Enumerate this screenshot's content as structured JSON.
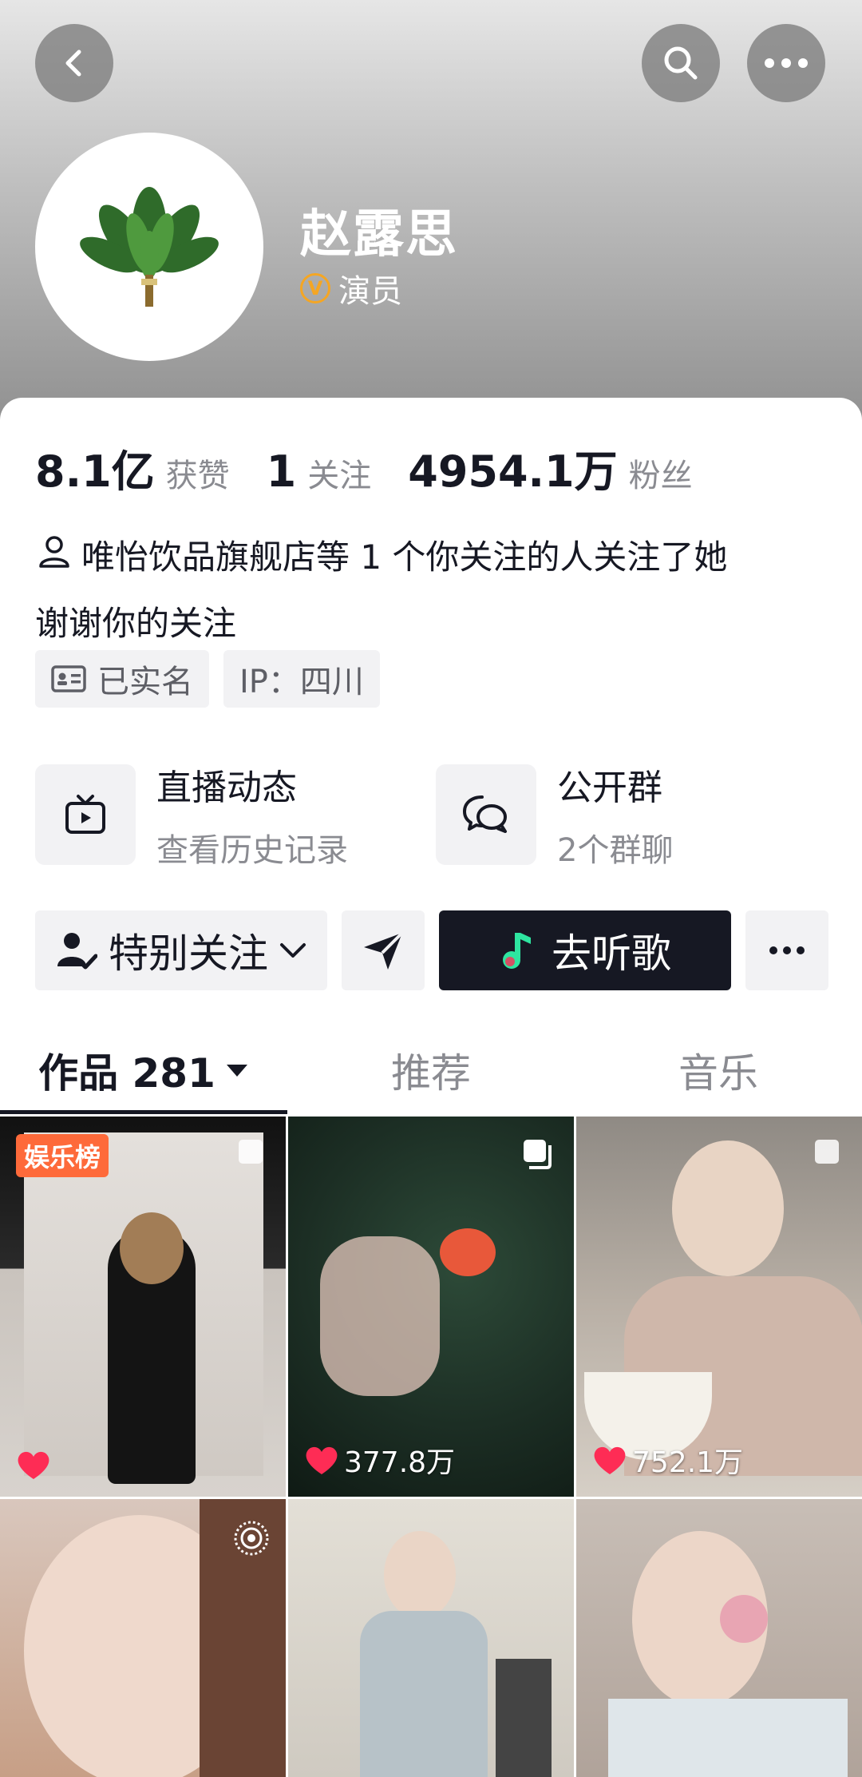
{
  "profile": {
    "name": "赵露思",
    "verify_title": "演员",
    "verify_icon": "v-badge-icon"
  },
  "stats": {
    "likes_value": "8.1亿",
    "likes_label": "获赞",
    "following_value": "1",
    "following_label": "关注",
    "followers_value": "4954.1万",
    "followers_label": "粉丝"
  },
  "mutual_text": "唯怡饮品旗舰店等 1 个你关注的人关注了她",
  "bio": "谢谢你的关注",
  "tags": {
    "verified_label": "已实名",
    "ip_label": "IP：四川"
  },
  "features": {
    "live_title": "直播动态",
    "live_sub": "查看历史记录",
    "group_title": "公开群",
    "group_sub": "2个群聊"
  },
  "actions": {
    "follow_label": "特别关注",
    "listen_label": "去听歌"
  },
  "tabs": {
    "works_label": "作品 281",
    "recommend_label": "推荐",
    "music_label": "音乐"
  },
  "videos": {
    "v1_badge": "娱乐榜",
    "v2_likes": "377.8万",
    "v3_likes": "752.1万"
  },
  "colors": {
    "accent_dark": "#161823",
    "like_red": "#fe2c55",
    "badge_orange": "#fe6a3a",
    "verify_gold": "#f5a623"
  }
}
